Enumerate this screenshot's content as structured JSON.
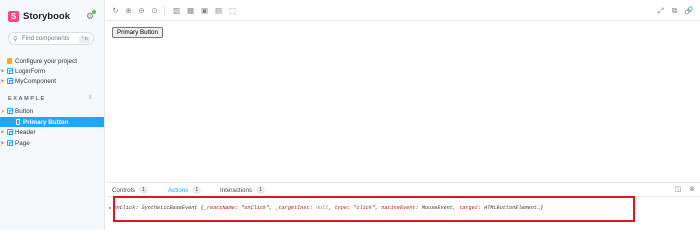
{
  "brand": {
    "logo_letter": "S",
    "name": "Storybook",
    "settings_icon": "gear-icon"
  },
  "search": {
    "placeholder": "Find components",
    "shortcut": "⌃K"
  },
  "sidebar": {
    "items": [
      {
        "label": "Configure your project",
        "icon": "document-icon"
      },
      {
        "label": "LoginForm",
        "icon": "component-icon"
      },
      {
        "label": "MyComponent",
        "icon": "component-icon"
      }
    ],
    "section_label": "EXAMPLE",
    "example_items": [
      {
        "label": "Button",
        "icon": "component-icon"
      },
      {
        "label": "Primary Button",
        "icon": "story-icon",
        "selected": true
      },
      {
        "label": "Header",
        "icon": "component-icon"
      },
      {
        "label": "Page",
        "icon": "component-icon"
      }
    ]
  },
  "toolbar": {
    "icons": [
      "reload-icon",
      "zoom-in-icon",
      "zoom-out-icon",
      "zoom-reset-icon",
      "background-icon",
      "grid-icon",
      "viewport-icon",
      "measure-icon",
      "outline-icon"
    ],
    "right_icons": [
      "fullscreen-icon",
      "open-new-tab-icon",
      "copy-link-icon"
    ]
  },
  "canvas": {
    "button_label": "Primary Button"
  },
  "panel": {
    "tabs": [
      {
        "label": "Controls",
        "count": "1"
      },
      {
        "label": "Actions",
        "count": "1",
        "active": true
      },
      {
        "label": "Interactions",
        "count": "1"
      }
    ],
    "log": {
      "name": "onClick:",
      "type": "SyntheticBaseEvent",
      "open_brace": "{",
      "k1": "_reactName:",
      "v1": "\"onClick\"",
      "k2": "_targetInst:",
      "v2": "null",
      "k3": "type:",
      "v3": "\"click\"",
      "k4": "nativeEvent:",
      "v4": "MouseEvent",
      "k5": "target:",
      "v5": "HTMLButtonElement",
      "ellipsis": "…}"
    }
  },
  "colors": {
    "accent": "#1ea7fd",
    "brand": "#ff4785",
    "highlight_border": "#e0161d"
  }
}
